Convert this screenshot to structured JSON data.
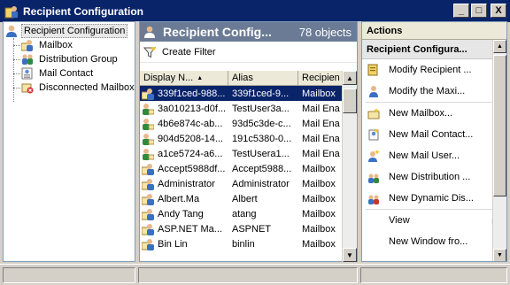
{
  "window": {
    "title": "Recipient Configuration",
    "buttons": [
      "_",
      "□",
      "X"
    ]
  },
  "tree": {
    "root": "Recipient Configuration",
    "items": [
      {
        "label": "Mailbox",
        "icon": "mailbox-icon"
      },
      {
        "label": "Distribution Group",
        "icon": "distribution-group-icon"
      },
      {
        "label": "Mail Contact",
        "icon": "mail-contact-icon"
      },
      {
        "label": "Disconnected Mailbox",
        "icon": "disconnected-mailbox-icon"
      }
    ]
  },
  "center": {
    "title": "Recipient Config...",
    "count": "78 objects",
    "toolbar": {
      "create_filter": "Create Filter"
    },
    "columns": [
      "Display N...",
      "Alias",
      "Recipien"
    ],
    "sort_indicator": "▲",
    "rows": [
      {
        "name": "339f1ced-988...",
        "alias": "339f1ced-9...",
        "type": "Mailbox",
        "selected": true
      },
      {
        "name": "3a010213-d0f...",
        "alias": "TestUser3a...",
        "type": "Mail Ena"
      },
      {
        "name": "4b6e874c-ab...",
        "alias": "93d5c3de-c...",
        "type": "Mail Ena"
      },
      {
        "name": "904d5208-14...",
        "alias": "191c5380-0...",
        "type": "Mail Ena"
      },
      {
        "name": "a1ce5724-a6...",
        "alias": "TestUsera1...",
        "type": "Mail Ena"
      },
      {
        "name": "Accept5988df...",
        "alias": "Accept5988...",
        "type": "Mailbox"
      },
      {
        "name": "Administrator",
        "alias": "Administrator",
        "type": "Mailbox"
      },
      {
        "name": "Albert.Ma",
        "alias": "Albert",
        "type": "Mailbox"
      },
      {
        "name": "Andy Tang",
        "alias": "atang",
        "type": "Mailbox"
      },
      {
        "name": "ASP.NET Ma...",
        "alias": "ASPNET",
        "type": "Mailbox"
      },
      {
        "name": "Bin Lin",
        "alias": "binlin",
        "type": "Mailbox"
      }
    ]
  },
  "actions": {
    "header": "Actions",
    "section": "Recipient Configura...",
    "items": [
      {
        "label": "Modify Recipient ...",
        "icon": "modify-recipient-icon"
      },
      {
        "label": "Modify the Maxi...",
        "icon": "modify-max-icon"
      },
      {
        "label": "New Mailbox...",
        "icon": "new-mailbox-icon"
      },
      {
        "label": "New Mail Contact...",
        "icon": "new-mail-contact-icon"
      },
      {
        "label": "New Mail User...",
        "icon": "new-mail-user-icon"
      },
      {
        "label": "New Distribution ...",
        "icon": "new-distribution-icon"
      },
      {
        "label": "New Dynamic Dis...",
        "icon": "new-dynamic-dis-icon"
      },
      {
        "label": "View",
        "icon": "",
        "submenu": true
      },
      {
        "label": "New Window fro...",
        "icon": ""
      }
    ]
  },
  "colors": {
    "titlebar": "#0a246a",
    "selection": "#0a246a",
    "center_header": "#6b7b95"
  }
}
